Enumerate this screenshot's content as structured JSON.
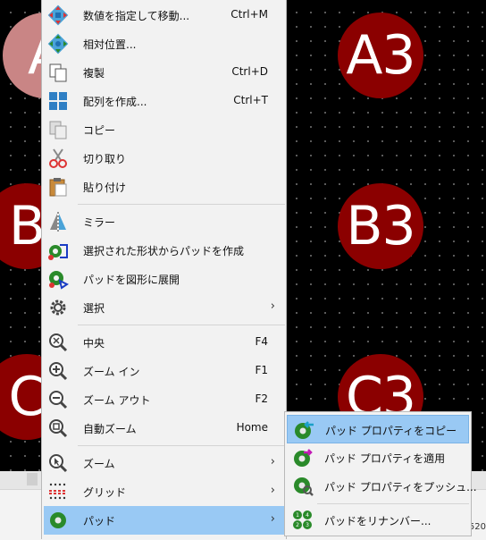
{
  "canvas": {
    "pads": [
      "A",
      "A3",
      "B",
      "B3",
      "C",
      "C3"
    ]
  },
  "statusbar": {
    "coord_text": "520"
  },
  "context_menu": {
    "items": [
      {
        "label": "数値を指定して移動...",
        "shortcut": "Ctrl+M",
        "icon": "move-exact-icon"
      },
      {
        "label": "相対位置...",
        "shortcut": "",
        "icon": "relative-position-icon"
      },
      {
        "label": "複製",
        "shortcut": "Ctrl+D",
        "icon": "duplicate-icon"
      },
      {
        "label": "配列を作成...",
        "shortcut": "Ctrl+T",
        "icon": "array-icon"
      },
      {
        "label": "コピー",
        "shortcut": "",
        "icon": "copy-icon"
      },
      {
        "label": "切り取り",
        "shortcut": "",
        "icon": "scissors-icon"
      },
      {
        "label": "貼り付け",
        "shortcut": "",
        "icon": "paste-icon"
      },
      {
        "label": "ミラー",
        "shortcut": "",
        "icon": "mirror-icon"
      },
      {
        "label": "選択された形状からパッドを作成",
        "shortcut": "",
        "icon": "pad-from-shapes-icon"
      },
      {
        "label": "パッドを図形に展開",
        "shortcut": "",
        "icon": "explode-pad-icon"
      },
      {
        "label": "選択",
        "shortcut": "",
        "icon": "gear-icon",
        "submenu": true
      },
      {
        "label": "中央",
        "shortcut": "F4",
        "icon": "zoom-center-icon"
      },
      {
        "label": "ズーム イン",
        "shortcut": "F1",
        "icon": "zoom-in-icon"
      },
      {
        "label": "ズーム アウト",
        "shortcut": "F2",
        "icon": "zoom-out-icon"
      },
      {
        "label": "自動ズーム",
        "shortcut": "Home",
        "icon": "zoom-fit-icon"
      },
      {
        "label": "ズーム",
        "shortcut": "",
        "icon": "zoom-cursor-icon",
        "submenu": true
      },
      {
        "label": "グリッド",
        "shortcut": "",
        "icon": "grid-icon",
        "submenu": true
      },
      {
        "label": "パッド",
        "shortcut": "",
        "icon": "pad-icon",
        "submenu": true,
        "highlighted": true
      }
    ]
  },
  "pad_submenu": {
    "items": [
      {
        "label": "パッド プロパティをコピー",
        "icon": "copy-pad-properties-icon",
        "highlighted": true
      },
      {
        "label": "パッド プロパティを適用",
        "icon": "apply-pad-properties-icon"
      },
      {
        "label": "パッド プロパティをプッシュ...",
        "icon": "push-pad-properties-icon"
      },
      {
        "label": "パッドをリナンバー...",
        "icon": "renumber-pads-icon"
      }
    ]
  },
  "colors": {
    "pad": "#8b0000",
    "highlight": "#99c9f4",
    "menu_bg": "#f2f2f2"
  }
}
